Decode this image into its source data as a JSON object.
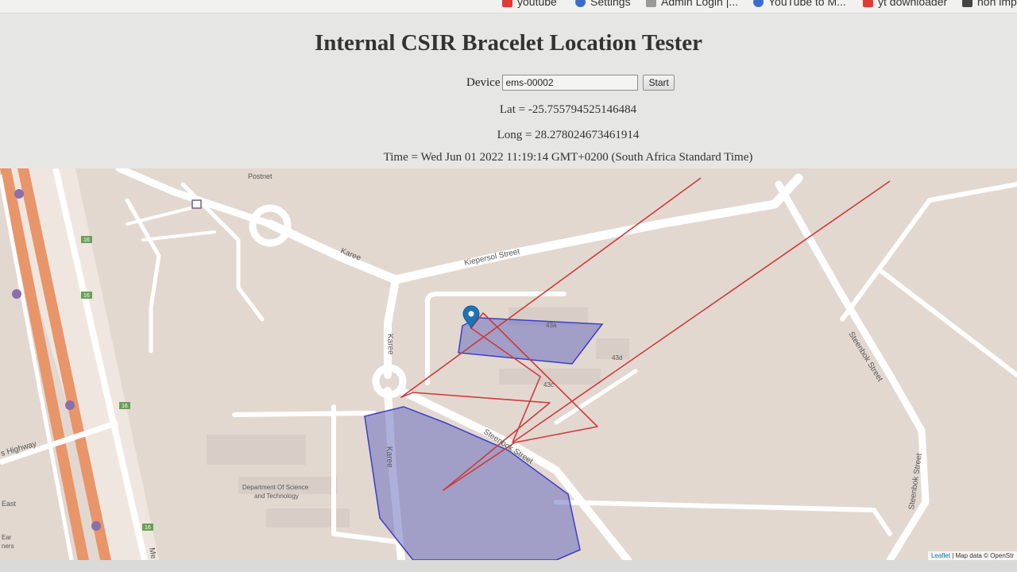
{
  "bookmarks": [
    {
      "label": "youtube",
      "icon": "youtube-icon",
      "color": "#e53935"
    },
    {
      "label": "Settings",
      "icon": "gear-icon",
      "color": "#3b6ecb"
    },
    {
      "label": "Admin Login |...",
      "icon": "admin-icon",
      "color": "#777777"
    },
    {
      "label": "YouTube to M...",
      "icon": "download-icon",
      "color": "#3b6ecb"
    },
    {
      "label": "yt downloader",
      "icon": "yt-downloader-icon",
      "color": "#e53935"
    },
    {
      "label": "non imp",
      "icon": "folder-icon",
      "color": "#444444"
    }
  ],
  "page": {
    "title": "Internal CSIR Bracelet Location Tester",
    "device_label": "Device",
    "device_value": "ems-00002",
    "start_label": "Start",
    "lat_text": "Lat = -25.755794525146484",
    "long_text": "Long = 28.278024673461914",
    "time_text": "Time = Wed Jun 01 2022 11:19:14 GMT+0200 (South Africa Standard Time)"
  },
  "map": {
    "labels": {
      "postnet": "Postnet",
      "karee_1": "Karee",
      "kiepersol": "Kiepersol Street",
      "karee_2": "Karee",
      "karee_3": "Karee",
      "steenbok_1": "Steenbok Street",
      "steenbok_2": "Steenbok Street",
      "steenbok_3": "Steenbok Street",
      "highway": "s Highway",
      "dst_1": "Department Of Science",
      "dst_2": "and Technology",
      "b43a": "43a",
      "b43c": "43c",
      "b43d": "43d",
      "east": "East",
      "m": "Me",
      "route_16": "16",
      "ear_1": "Ear",
      "ear_2": "ners"
    },
    "attribution": {
      "leaflet": "Leaflet",
      "rest": " | Map data © OpenStr"
    },
    "colors": {
      "zone_fill": "#6b6fc0",
      "zone_stroke": "#3b3fc4",
      "trail": "#d03a3a",
      "marker": "#1f72b8",
      "highway": "#e8956a"
    }
  }
}
